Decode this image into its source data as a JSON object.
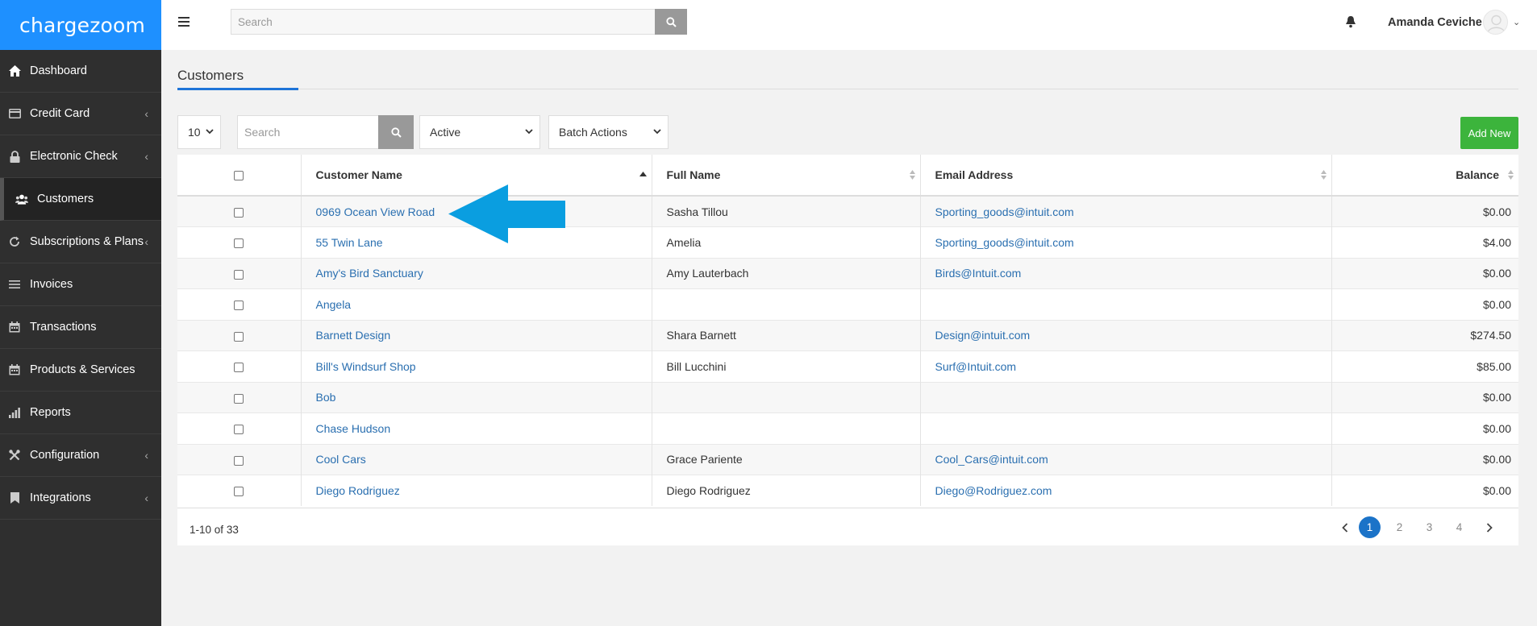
{
  "app": {
    "logo": "chargezoom"
  },
  "sidebar": {
    "items": [
      {
        "label": "Dashboard",
        "icon": "home-icon",
        "has_submenu": false
      },
      {
        "label": "Credit Card",
        "icon": "credit-card-icon",
        "has_submenu": true
      },
      {
        "label": "Electronic Check",
        "icon": "lock-icon",
        "has_submenu": true
      },
      {
        "label": "Customers",
        "icon": "users-icon",
        "has_submenu": false,
        "active": true
      },
      {
        "label": "Subscriptions & Plans",
        "icon": "refresh-icon",
        "has_submenu": true
      },
      {
        "label": "Invoices",
        "icon": "list-icon",
        "has_submenu": false
      },
      {
        "label": "Transactions",
        "icon": "calendar-icon",
        "has_submenu": false
      },
      {
        "label": "Products & Services",
        "icon": "calendar-icon",
        "has_submenu": false
      },
      {
        "label": "Reports",
        "icon": "bar-chart-icon",
        "has_submenu": false
      },
      {
        "label": "Configuration",
        "icon": "wrench-icon",
        "has_submenu": true
      },
      {
        "label": "Integrations",
        "icon": "bookmark-icon",
        "has_submenu": true
      }
    ]
  },
  "header": {
    "search_placeholder": "Search",
    "user_name": "Amanda Ceviche"
  },
  "main": {
    "title": "Customers",
    "per_page": "10",
    "table_search_placeholder": "Search",
    "status_filter": "Active",
    "batch_actions": "Batch Actions",
    "add_new_label": "Add New"
  },
  "table": {
    "columns": [
      "Customer Name",
      "Full Name",
      "Email Address",
      "Balance"
    ],
    "rows": [
      {
        "customer": "0969 Ocean View Road",
        "full_name": "Sasha Tillou",
        "email": "Sporting_goods@intuit.com",
        "balance": "$0.00"
      },
      {
        "customer": "55 Twin Lane",
        "full_name": "Amelia",
        "email": "Sporting_goods@intuit.com",
        "balance": "$4.00"
      },
      {
        "customer": "Amy's Bird Sanctuary",
        "full_name": "Amy Lauterbach",
        "email": "Birds@Intuit.com",
        "balance": "$0.00"
      },
      {
        "customer": "Angela",
        "full_name": "",
        "email": "",
        "balance": "$0.00"
      },
      {
        "customer": "Barnett Design",
        "full_name": "Shara Barnett",
        "email": "Design@intuit.com",
        "balance": "$274.50"
      },
      {
        "customer": "Bill's Windsurf Shop",
        "full_name": "Bill Lucchini",
        "email": "Surf@Intuit.com",
        "balance": "$85.00"
      },
      {
        "customer": "Bob",
        "full_name": "",
        "email": "",
        "balance": "$0.00"
      },
      {
        "customer": "Chase Hudson",
        "full_name": "",
        "email": "",
        "balance": "$0.00"
      },
      {
        "customer": "Cool Cars",
        "full_name": "Grace Pariente",
        "email": "Cool_Cars@intuit.com",
        "balance": "$0.00"
      },
      {
        "customer": "Diego Rodriguez",
        "full_name": "Diego Rodriguez",
        "email": "Diego@Rodriguez.com",
        "balance": "$0.00"
      }
    ]
  },
  "pagination": {
    "summary_range": "1-10",
    "summary_of": "of",
    "summary_total": "33",
    "pages": [
      "1",
      "2",
      "3",
      "4"
    ],
    "current_page": "1"
  },
  "colors": {
    "brand_blue": "#1e90ff",
    "sidebar_bg": "#2f2f2f",
    "link": "#2a6fb0",
    "add_new_green": "#3cb43c",
    "annotation_arrow": "#0a9ee0"
  }
}
